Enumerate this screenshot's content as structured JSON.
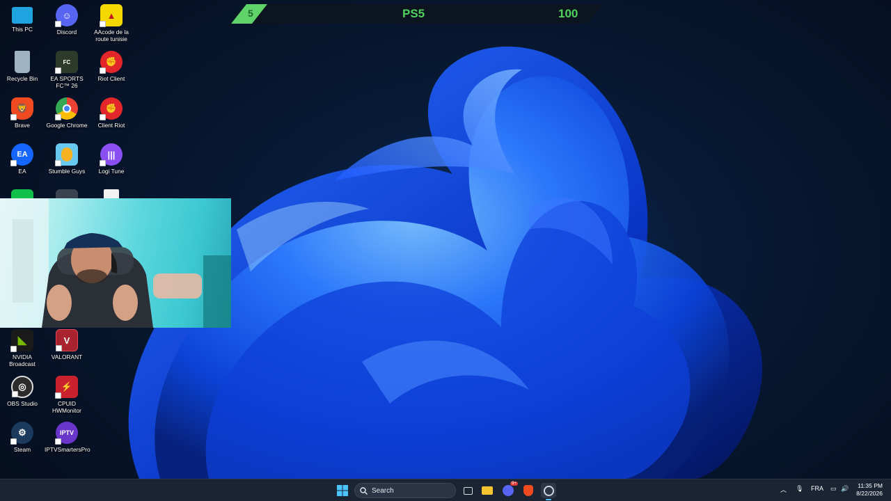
{
  "score_bar": {
    "number": "5",
    "title": "PS5",
    "value": "100"
  },
  "desktop_icons": [
    {
      "label": "This PC",
      "icon": "monitor-icon",
      "color": "#1fa4e0"
    },
    {
      "label": "Discord",
      "icon": "discord-icon",
      "color": "#5865f2"
    },
    {
      "label": "AAcode de la route tunisie",
      "icon": "car-app-icon",
      "color": "#f5d800"
    },
    {
      "label": "Recycle Bin",
      "icon": "recycle-bin-icon",
      "color": "#9fb3c4"
    },
    {
      "label": "EA SPORTS FC™ 26",
      "icon": "ea-fc-icon",
      "color": "#2e3a2a"
    },
    {
      "label": "Riot Client",
      "icon": "riot-icon",
      "color": "#e3262c"
    },
    {
      "label": "Brave",
      "icon": "brave-icon",
      "color": "#f04a20"
    },
    {
      "label": "Google Chrome",
      "icon": "chrome-icon",
      "color": "#34a853"
    },
    {
      "label": "Client Riot",
      "icon": "riot-icon",
      "color": "#e3262c"
    },
    {
      "label": "EA",
      "icon": "ea-icon",
      "color": "#1565ff"
    },
    {
      "label": "Stumble Guys",
      "icon": "stumble-guys-icon",
      "color": "#69c8f0"
    },
    {
      "label": "Logi Tune",
      "icon": "logi-tune-icon",
      "color": "#8a4ff2"
    },
    {
      "label": "NVIDIA Broadcast",
      "icon": "nvidia-icon",
      "color": "#76b900"
    },
    {
      "label": "VALORANT",
      "icon": "valorant-icon",
      "color": "#a8232f"
    },
    {
      "label": "OBS Studio",
      "icon": "obs-icon",
      "color": "#2b2b2b"
    },
    {
      "label": "CPUID HWMonitor",
      "icon": "hwmonitor-icon",
      "color": "#c9212d"
    },
    {
      "label": "Steam",
      "icon": "steam-icon",
      "color": "#1b3a5c"
    },
    {
      "label": "IPTVSmartersPro",
      "icon": "iptv-icon",
      "color": "#6a35c9"
    }
  ],
  "taskbar": {
    "search_placeholder": "Search",
    "language": "FRA",
    "time": "11:35 PM",
    "date": "8/22/2026",
    "discord_badge": "9+"
  }
}
